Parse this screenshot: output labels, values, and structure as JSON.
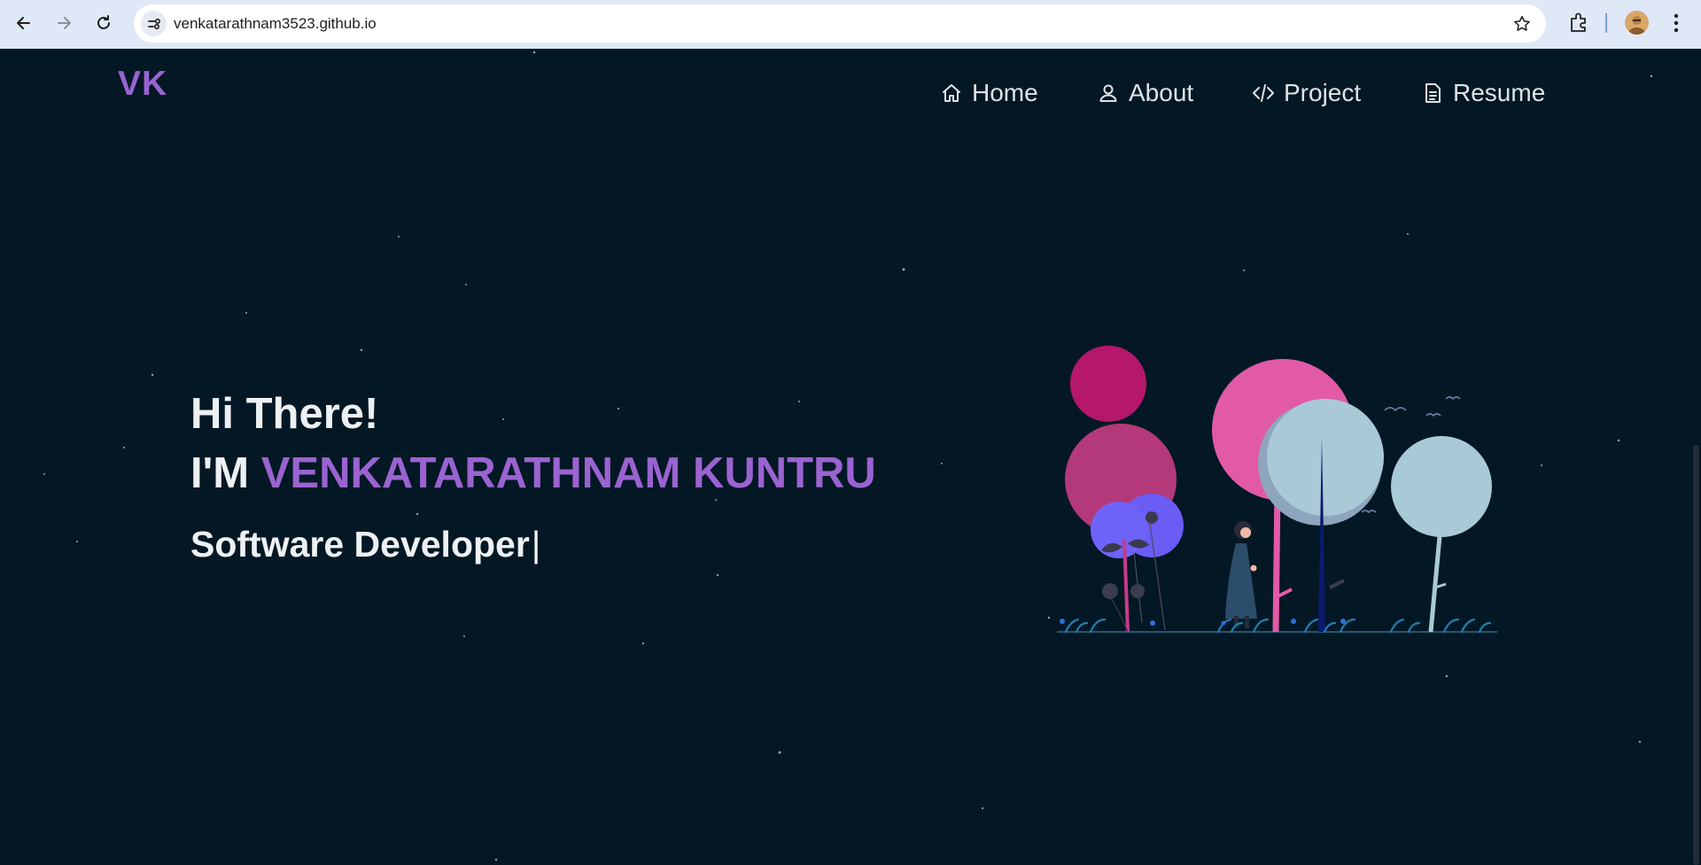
{
  "browser": {
    "url": "venkatarathnam3523.github.io",
    "icons": [
      "back-icon",
      "forward-icon",
      "reload-icon",
      "site-info-icon",
      "bookmark-star-icon",
      "extensions-icon",
      "profile-avatar",
      "menu-kebab-icon"
    ]
  },
  "header": {
    "logo": "VK",
    "nav": [
      {
        "label": "Home",
        "icon": "home-icon"
      },
      {
        "label": "About",
        "icon": "user-icon"
      },
      {
        "label": "Project",
        "icon": "code-icon"
      },
      {
        "label": "Resume",
        "icon": "document-icon"
      }
    ]
  },
  "hero": {
    "greeting": "Hi There!",
    "intro_prefix": "I'M",
    "name": "VENKATARATHNAM KUNTRU",
    "role": "Software Developer",
    "cursor": "|"
  },
  "colors": {
    "background": "#031824",
    "accent": "#9a63d1",
    "text": "#eef1f4",
    "chrome": "#dfe8f7"
  }
}
